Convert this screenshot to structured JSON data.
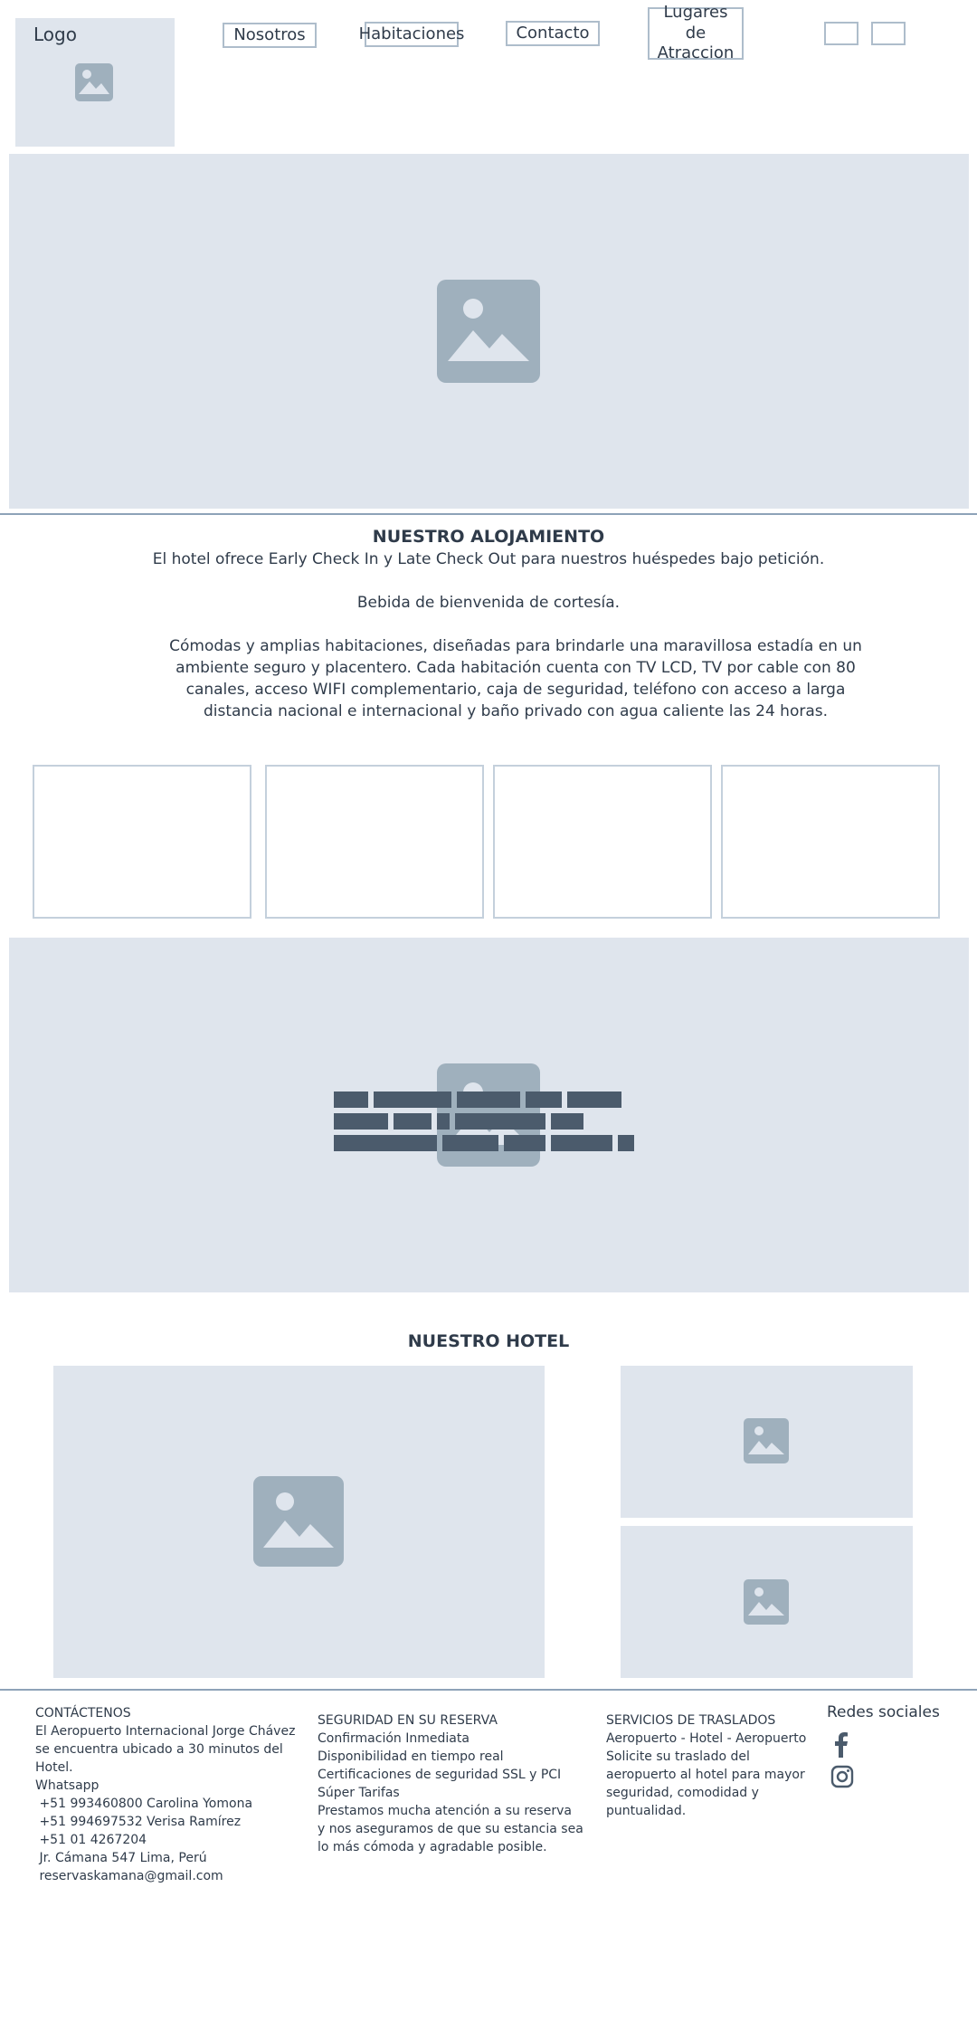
{
  "header": {
    "logo_label": "Logo",
    "nav": [
      "Nosotros",
      "Habitaciones",
      "Contacto",
      "Lugares de Atraccion"
    ]
  },
  "accommodation": {
    "title": "NUESTRO ALOJAMIENTO",
    "p1": "El hotel ofrece Early Check In y Late Check Out para nuestros huéspedes bajo petición.",
    "p2": "Bebida de bienvenida de cortesía.",
    "p3": "Cómodas y amplias habitaciones, diseñadas para brindarle una maravillosa estadía en un ambiente seguro y placentero. Cada habitación cuenta con TV LCD, TV por cable con 80 canales, acceso WIFI complementario, caja de seguridad, teléfono con acceso a larga distancia nacional e internacional y baño privado con agua caliente las 24 horas."
  },
  "hotel": {
    "title": "NUESTRO HOTEL"
  },
  "footer": {
    "contact": {
      "heading": "CONTÁCTENOS",
      "lines": [
        "El Aeropuerto Internacional Jorge Chávez",
        "se encuentra ubicado a 30 minutos del",
        "Hotel.",
        "Whatsapp",
        " +51 993460800 Carolina Yomona",
        " +51 994697532 Verisa Ramírez",
        " +51 01 4267204",
        " Jr. Cámana 547 Lima, Perú",
        " reservaskamana@gmail.com"
      ]
    },
    "security": {
      "heading": "SEGURIDAD EN SU RESERVA",
      "lines": [
        "Confirmación Inmediata",
        "Disponibilidad en tiempo real",
        "Certificaciones de seguridad SSL y PCI",
        "Súper Tarifas",
        "Prestamos mucha atención a su reserva",
        "y nos aseguramos de que su estancia sea",
        "lo más cómoda y agradable posible."
      ]
    },
    "transfers": {
      "heading": "SERVICIOS DE TRASLADOS",
      "lines": [
        "Aeropuerto - Hotel - Aeropuerto",
        "Solicite su traslado del",
        "aeropuerto al hotel para mayor",
        "seguridad, comodidad y",
        "puntualidad."
      ]
    },
    "social": {
      "heading": "Redes sociales",
      "icons": [
        "facebook-icon",
        "instagram-icon"
      ]
    }
  }
}
